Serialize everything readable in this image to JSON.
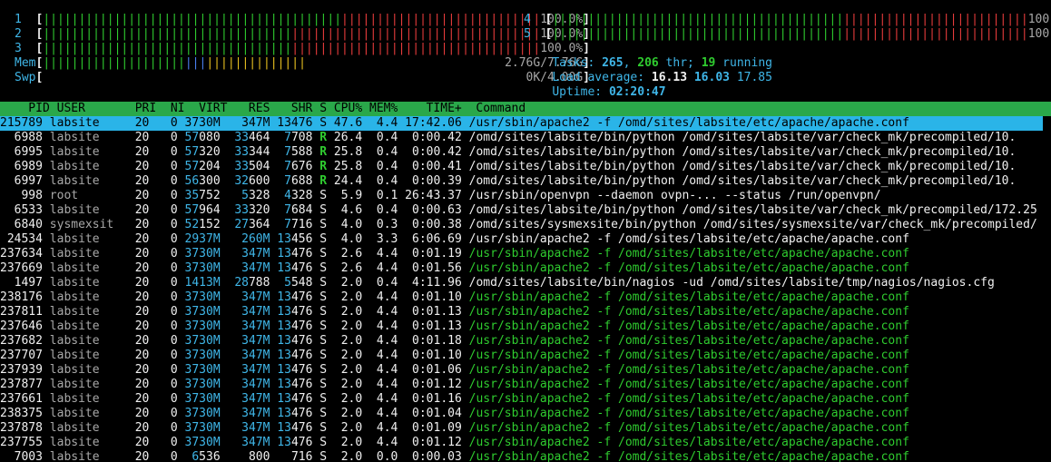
{
  "meters": {
    "cpu": [
      {
        "label": "1",
        "green": 42,
        "red": 28,
        "value": "100.0%"
      },
      {
        "label": "2",
        "green": 35,
        "red": 35,
        "value": "100.0%"
      },
      {
        "label": "3",
        "green": 35,
        "red": 35,
        "value": "100.0%"
      },
      {
        "label": "4",
        "green": 41,
        "red": 26,
        "value": "100.0%"
      },
      {
        "label": "5",
        "green": 41,
        "red": 26,
        "value": "100.0%"
      }
    ],
    "mem": {
      "label": "Mem",
      "green": 20,
      "blue": 3,
      "yellow": 14,
      "value": "2.76G/7.76G",
      "fraction": 0.356
    },
    "swp": {
      "label": "Swp",
      "value": "0K/4.00G",
      "fraction": 0.0
    }
  },
  "stats": {
    "tasks_label": "Tasks: ",
    "tasks": "265",
    "sep1": ", ",
    "threads": "206",
    "thr_label": " thr; ",
    "running": "19",
    "running_label": " running",
    "load_label": "Load average: ",
    "load1": "16.13",
    "load5": "16.03",
    "load15": "17.85",
    "uptime_label": "Uptime: ",
    "uptime": "02:20:47"
  },
  "header": {
    "text": "    PID USER       PRI  NI  VIRT   RES   SHR S CPU% MEM%    TIME+  Command"
  },
  "processes": [
    {
      "pid": "215789",
      "user": "labsite",
      "pri": "20",
      "ni": "0",
      "virt": "3730M",
      "res": "347M",
      "shr": "13476",
      "s": "S",
      "cpu": "47.6",
      "mem": "4.4",
      "time": "17:42.06",
      "cmd": "/usr/sbin/apache2 -f /omd/sites/labsite/etc/apache/apache.conf",
      "kind": "selected"
    },
    {
      "pid": "6988",
      "user": "labsite",
      "pri": "20",
      "ni": "0",
      "virt": "57080",
      "res": "33464",
      "shr": "7708",
      "s": "R",
      "cpu": "26.4",
      "mem": "0.4",
      "time": "0:00.42",
      "cmd": "/omd/sites/labsite/bin/python /omd/sites/labsite/var/check_mk/precompiled/10.",
      "kind": "normal"
    },
    {
      "pid": "6995",
      "user": "labsite",
      "pri": "20",
      "ni": "0",
      "virt": "57320",
      "res": "33344",
      "shr": "7588",
      "s": "R",
      "cpu": "25.8",
      "mem": "0.4",
      "time": "0:00.42",
      "cmd": "/omd/sites/labsite/bin/python /omd/sites/labsite/var/check_mk/precompiled/10.",
      "kind": "normal"
    },
    {
      "pid": "6989",
      "user": "labsite",
      "pri": "20",
      "ni": "0",
      "virt": "57204",
      "res": "33504",
      "shr": "7676",
      "s": "R",
      "cpu": "25.8",
      "mem": "0.4",
      "time": "0:00.41",
      "cmd": "/omd/sites/labsite/bin/python /omd/sites/labsite/var/check_mk/precompiled/10.",
      "kind": "normal"
    },
    {
      "pid": "6997",
      "user": "labsite",
      "pri": "20",
      "ni": "0",
      "virt": "56300",
      "res": "32600",
      "shr": "7688",
      "s": "R",
      "cpu": "24.4",
      "mem": "0.4",
      "time": "0:00.39",
      "cmd": "/omd/sites/labsite/bin/python /omd/sites/labsite/var/check_mk/precompiled/10.",
      "kind": "normal"
    },
    {
      "pid": "998",
      "user": "root",
      "pri": "20",
      "ni": "0",
      "virt": "35752",
      "res": "5328",
      "shr": "4328",
      "s": "S",
      "cpu": "5.9",
      "mem": "0.1",
      "time": "26:43.37",
      "cmd": "/usr/sbin/openvpn --daemon ovpn-... --status /run/openvpn/",
      "kind": "normal"
    },
    {
      "pid": "6533",
      "user": "labsite",
      "pri": "20",
      "ni": "0",
      "virt": "57964",
      "res": "33320",
      "shr": "7684",
      "s": "S",
      "cpu": "4.6",
      "mem": "0.4",
      "time": "0:00.63",
      "cmd": "/omd/sites/labsite/bin/python /omd/sites/labsite/var/check_mk/precompiled/172.25",
      "kind": "normal"
    },
    {
      "pid": "6840",
      "user": "sysmexsit",
      "pri": "20",
      "ni": "0",
      "virt": "52152",
      "res": "27364",
      "shr": "7716",
      "s": "S",
      "cpu": "4.0",
      "mem": "0.3",
      "time": "0:00.38",
      "cmd": "/omd/sites/sysmexsite/bin/python /omd/sites/sysmexsite/var/check_mk/precompiled/",
      "kind": "normal"
    },
    {
      "pid": "24534",
      "user": "labsite",
      "pri": "20",
      "ni": "0",
      "virt": "2937M",
      "res": "260M",
      "shr": "13456",
      "s": "S",
      "cpu": "4.0",
      "mem": "3.3",
      "time": "6:06.69",
      "cmd": "/usr/sbin/apache2 -f /omd/sites/labsite/etc/apache/apache.conf",
      "kind": "normal"
    },
    {
      "pid": "237634",
      "user": "labsite",
      "pri": "20",
      "ni": "0",
      "virt": "3730M",
      "res": "347M",
      "shr": "13476",
      "s": "S",
      "cpu": "2.6",
      "mem": "4.4",
      "time": "0:01.19",
      "cmd": "/usr/sbin/apache2 -f /omd/sites/labsite/etc/apache/apache.conf",
      "kind": "thread"
    },
    {
      "pid": "237669",
      "user": "labsite",
      "pri": "20",
      "ni": "0",
      "virt": "3730M",
      "res": "347M",
      "shr": "13476",
      "s": "S",
      "cpu": "2.6",
      "mem": "4.4",
      "time": "0:01.56",
      "cmd": "/usr/sbin/apache2 -f /omd/sites/labsite/etc/apache/apache.conf",
      "kind": "thread"
    },
    {
      "pid": "1497",
      "user": "labsite",
      "pri": "20",
      "ni": "0",
      "virt": "1413M",
      "res": "28788",
      "shr": "5548",
      "s": "S",
      "cpu": "2.0",
      "mem": "0.4",
      "time": "4:11.96",
      "cmd": "/omd/sites/labsite/bin/nagios -ud /omd/sites/labsite/tmp/nagios/nagios.cfg",
      "kind": "normal"
    },
    {
      "pid": "238176",
      "user": "labsite",
      "pri": "20",
      "ni": "0",
      "virt": "3730M",
      "res": "347M",
      "shr": "13476",
      "s": "S",
      "cpu": "2.0",
      "mem": "4.4",
      "time": "0:01.10",
      "cmd": "/usr/sbin/apache2 -f /omd/sites/labsite/etc/apache/apache.conf",
      "kind": "thread"
    },
    {
      "pid": "237811",
      "user": "labsite",
      "pri": "20",
      "ni": "0",
      "virt": "3730M",
      "res": "347M",
      "shr": "13476",
      "s": "S",
      "cpu": "2.0",
      "mem": "4.4",
      "time": "0:01.13",
      "cmd": "/usr/sbin/apache2 -f /omd/sites/labsite/etc/apache/apache.conf",
      "kind": "thread"
    },
    {
      "pid": "237646",
      "user": "labsite",
      "pri": "20",
      "ni": "0",
      "virt": "3730M",
      "res": "347M",
      "shr": "13476",
      "s": "S",
      "cpu": "2.0",
      "mem": "4.4",
      "time": "0:01.13",
      "cmd": "/usr/sbin/apache2 -f /omd/sites/labsite/etc/apache/apache.conf",
      "kind": "thread"
    },
    {
      "pid": "237682",
      "user": "labsite",
      "pri": "20",
      "ni": "0",
      "virt": "3730M",
      "res": "347M",
      "shr": "13476",
      "s": "S",
      "cpu": "2.0",
      "mem": "4.4",
      "time": "0:01.18",
      "cmd": "/usr/sbin/apache2 -f /omd/sites/labsite/etc/apache/apache.conf",
      "kind": "thread"
    },
    {
      "pid": "237707",
      "user": "labsite",
      "pri": "20",
      "ni": "0",
      "virt": "3730M",
      "res": "347M",
      "shr": "13476",
      "s": "S",
      "cpu": "2.0",
      "mem": "4.4",
      "time": "0:01.10",
      "cmd": "/usr/sbin/apache2 -f /omd/sites/labsite/etc/apache/apache.conf",
      "kind": "thread"
    },
    {
      "pid": "237939",
      "user": "labsite",
      "pri": "20",
      "ni": "0",
      "virt": "3730M",
      "res": "347M",
      "shr": "13476",
      "s": "S",
      "cpu": "2.0",
      "mem": "4.4",
      "time": "0:01.06",
      "cmd": "/usr/sbin/apache2 -f /omd/sites/labsite/etc/apache/apache.conf",
      "kind": "thread"
    },
    {
      "pid": "237877",
      "user": "labsite",
      "pri": "20",
      "ni": "0",
      "virt": "3730M",
      "res": "347M",
      "shr": "13476",
      "s": "S",
      "cpu": "2.0",
      "mem": "4.4",
      "time": "0:01.12",
      "cmd": "/usr/sbin/apache2 -f /omd/sites/labsite/etc/apache/apache.conf",
      "kind": "thread"
    },
    {
      "pid": "237661",
      "user": "labsite",
      "pri": "20",
      "ni": "0",
      "virt": "3730M",
      "res": "347M",
      "shr": "13476",
      "s": "S",
      "cpu": "2.0",
      "mem": "4.4",
      "time": "0:01.16",
      "cmd": "/usr/sbin/apache2 -f /omd/sites/labsite/etc/apache/apache.conf",
      "kind": "thread"
    },
    {
      "pid": "238375",
      "user": "labsite",
      "pri": "20",
      "ni": "0",
      "virt": "3730M",
      "res": "347M",
      "shr": "13476",
      "s": "S",
      "cpu": "2.0",
      "mem": "4.4",
      "time": "0:01.04",
      "cmd": "/usr/sbin/apache2 -f /omd/sites/labsite/etc/apache/apache.conf",
      "kind": "thread"
    },
    {
      "pid": "237878",
      "user": "labsite",
      "pri": "20",
      "ni": "0",
      "virt": "3730M",
      "res": "347M",
      "shr": "13476",
      "s": "S",
      "cpu": "2.0",
      "mem": "4.4",
      "time": "0:01.09",
      "cmd": "/usr/sbin/apache2 -f /omd/sites/labsite/etc/apache/apache.conf",
      "kind": "thread"
    },
    {
      "pid": "237755",
      "user": "labsite",
      "pri": "20",
      "ni": "0",
      "virt": "3730M",
      "res": "347M",
      "shr": "13476",
      "s": "S",
      "cpu": "2.0",
      "mem": "4.4",
      "time": "0:01.12",
      "cmd": "/usr/sbin/apache2 -f /omd/sites/labsite/etc/apache/apache.conf",
      "kind": "thread"
    },
    {
      "pid": "7003",
      "user": "labsite",
      "pri": "20",
      "ni": "0",
      "virt": "6536",
      "res": "800",
      "shr": "716",
      "s": "S",
      "cpu": "2.0",
      "mem": "0.0",
      "time": "0:00.03",
      "cmd": "/usr/sbin/apache2 -f /omd/sites/labsite/etc/apache/apache.conf",
      "kind": "thread"
    }
  ]
}
